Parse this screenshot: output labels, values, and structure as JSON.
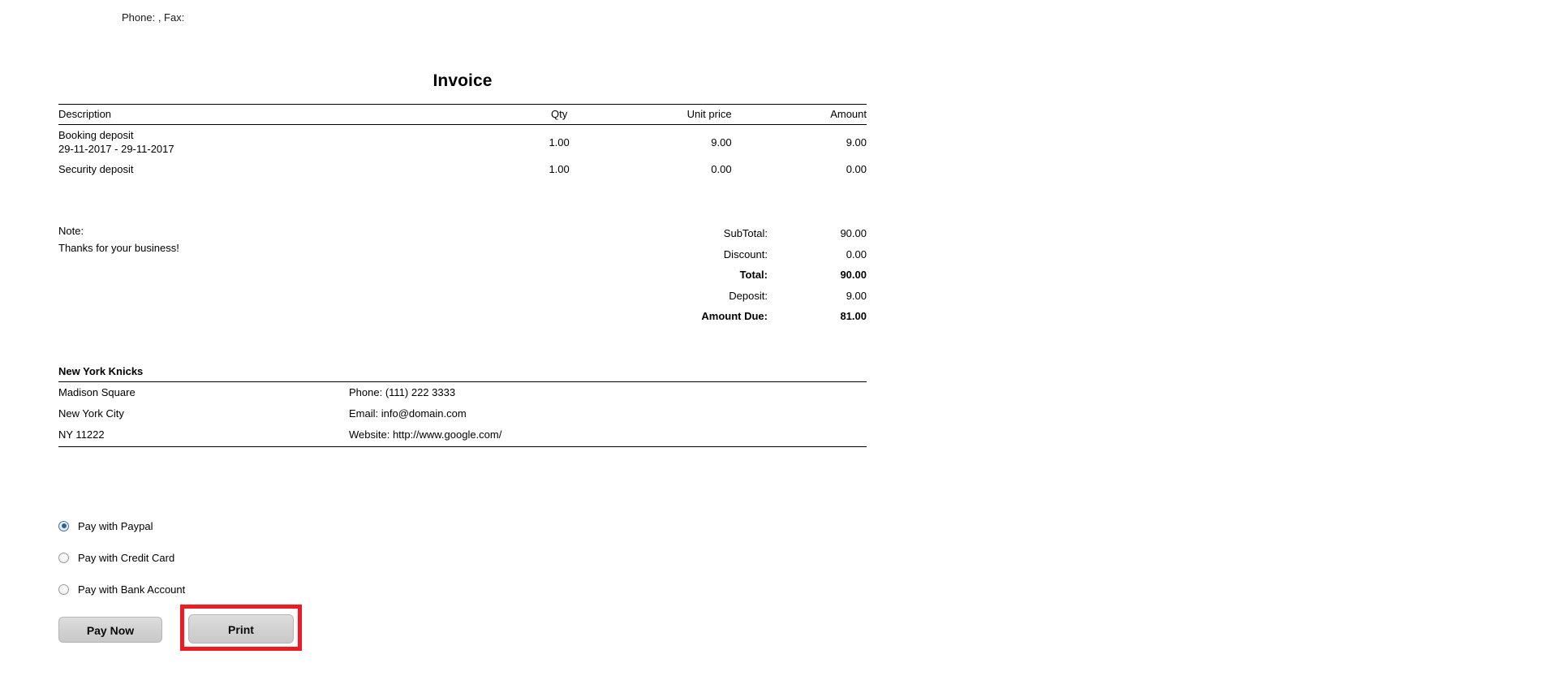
{
  "header": {
    "contact_line": "Phone: , Fax:"
  },
  "title": "Invoice",
  "items_table": {
    "columns": {
      "description": "Description",
      "qty": "Qty",
      "unit_price": "Unit price",
      "amount": "Amount"
    },
    "rows": [
      {
        "description": "Booking deposit",
        "description_sub": "29-11-2017 - 29-11-2017",
        "qty": "1.00",
        "unit_price": "9.00",
        "amount": "9.00"
      },
      {
        "description": "Security deposit",
        "description_sub": "",
        "qty": "1.00",
        "unit_price": "0.00",
        "amount": "0.00"
      }
    ]
  },
  "note": {
    "label": "Note:",
    "text": "Thanks for your business!"
  },
  "totals": [
    {
      "label": "SubTotal:",
      "value": "90.00",
      "bold": false
    },
    {
      "label": "Discount:",
      "value": "0.00",
      "bold": false
    },
    {
      "label": "Total:",
      "value": "90.00",
      "bold": true
    },
    {
      "label": "Deposit:",
      "value": "9.00",
      "bold": false
    },
    {
      "label": "Amount Due:",
      "value": "81.00",
      "bold": true
    }
  ],
  "company": {
    "name": "New York Knicks",
    "address_line1": "Madison Square",
    "address_line2": "New York City",
    "address_line3": "NY 11222",
    "phone": "Phone: (111) 222 3333",
    "email": "Email: info@domain.com",
    "website": "Website: http://www.google.com/"
  },
  "payment_options": [
    {
      "label": "Pay with Paypal",
      "selected": true
    },
    {
      "label": "Pay with Credit Card",
      "selected": false
    },
    {
      "label": "Pay with Bank Account",
      "selected": false
    }
  ],
  "actions": {
    "pay_now": "Pay Now",
    "print": "Print"
  },
  "colors": {
    "highlight": "#ee1c22",
    "radio_selected": "#2a6496",
    "button_face": "#d2d2d2"
  }
}
